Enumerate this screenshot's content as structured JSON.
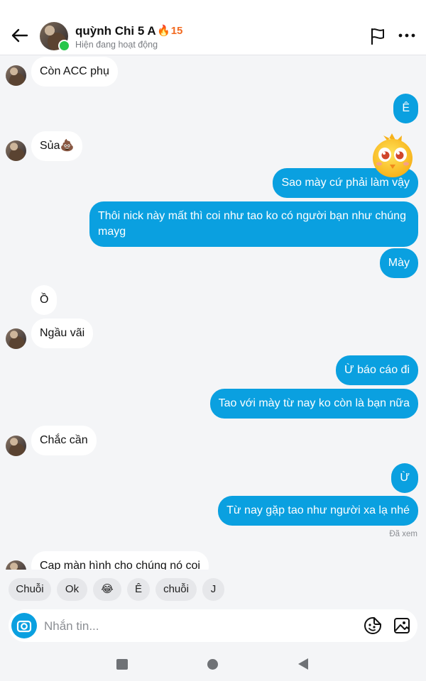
{
  "header": {
    "contact_name": "quỳnh Chi 5 A",
    "streak_count": "15",
    "status": "Hiện đang hoạt động",
    "icons": [
      "back-arrow-icon",
      "flag-icon",
      "more-dots-icon"
    ],
    "online_color": "#27c64a",
    "streak_color": "#f26b21"
  },
  "messages": [
    {
      "dir": "in",
      "text": "Còn ACC phụ"
    },
    {
      "dir": "out",
      "text": "Ê"
    },
    {
      "dir": "in",
      "text": "Sủa💩"
    },
    {
      "dir": "out",
      "text": "Sao mày cứ phải làm vậy"
    },
    {
      "dir": "out",
      "text": "Thôi nick này mất thì coi như tao ko có người bạn như chúng mayg"
    },
    {
      "dir": "out",
      "text": "Mày"
    },
    {
      "dir": "in",
      "text": "Ồ"
    },
    {
      "dir": "in",
      "text": "Ngầu vãi"
    },
    {
      "dir": "out",
      "text": "Ừ báo cáo đi"
    },
    {
      "dir": "out",
      "text": "Tao với mày từ nay ko còn là bạn nữa"
    },
    {
      "dir": "in",
      "text": "Chắc cần"
    },
    {
      "dir": "out",
      "text": "Ừ"
    },
    {
      "dir": "out",
      "text": "Từ nay gặp tao như người xa lạ nhé"
    },
    {
      "dir": "in",
      "text": "Cap màn hình cho chúng nó coi"
    }
  ],
  "seen_label": "Đã xem",
  "quick_replies": [
    "Chuỗi",
    "Ok",
    "😂",
    "Ê",
    "chuỗi",
    "J"
  ],
  "composer": {
    "placeholder": "Nhắn tin...",
    "icons": [
      "camera-icon",
      "sticker-icon",
      "image-icon"
    ]
  },
  "colors": {
    "accent": "#0aa0e0",
    "incoming_bubble": "#ffffff",
    "background": "#f4f5f7"
  }
}
